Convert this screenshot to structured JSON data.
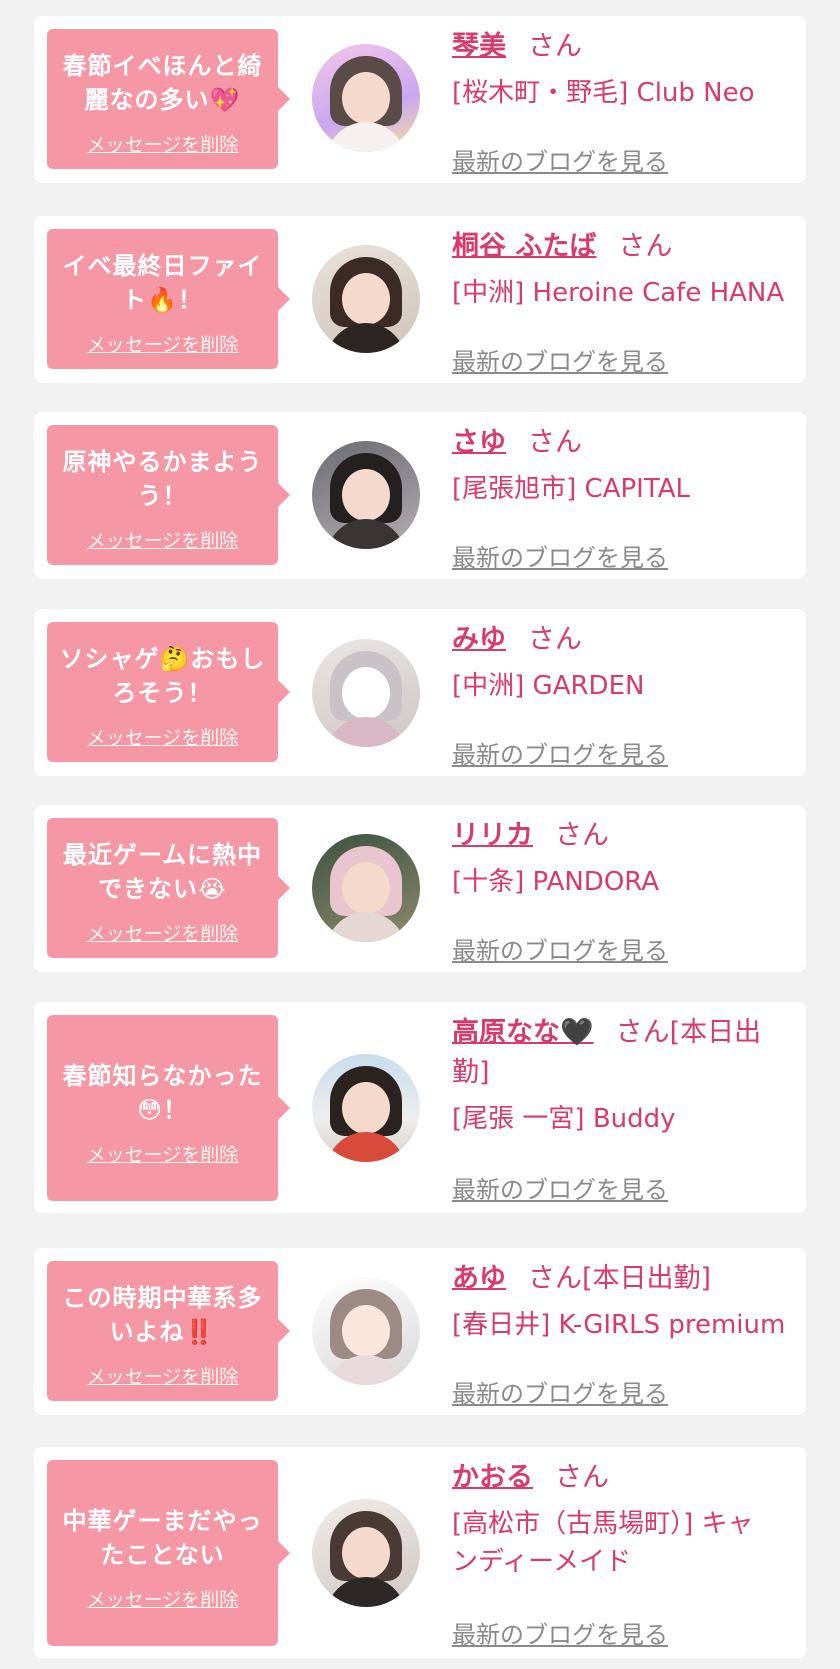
{
  "delete_label": "メッセージを削除",
  "blog_label": "最新のブログを見る",
  "san_suffix": "さん",
  "colors": {
    "accent": "#d93a6c",
    "bubble": "#f597a4",
    "background": "#f2f2f2"
  },
  "items": [
    {
      "message_a": "春節イベほんと綺",
      "message_b": "麗なの多い💖",
      "name": "琴美",
      "suffix": "さん",
      "shop": "[桜木町・野毛] Club Neo"
    },
    {
      "message_a": "イベ最終日ファイ",
      "message_b": "ト🔥！",
      "name": "桐谷 ふたば",
      "suffix": "さん",
      "shop": "[中洲] Heroine Cafe HANA"
    },
    {
      "message_a": "原神やるかまよう",
      "message_b": "う！",
      "name": "さゆ",
      "suffix": "さん",
      "shop": "[尾張旭市] CAPITAL"
    },
    {
      "message_a": "ソシャゲ🤔おもし",
      "message_b": "ろそう！",
      "name": "みゆ",
      "suffix": "さん",
      "shop": "[中洲] GARDEN"
    },
    {
      "message_a": "最近ゲームに熱中",
      "message_b": "できない😭",
      "name": "リリカ",
      "suffix": "さん",
      "shop": "[十条] PANDORA"
    },
    {
      "message_a": "春節知らなかった",
      "message_b": "😳！",
      "name": "高原なな🖤",
      "suffix": "さん[本日出",
      "suffix2": "勤]",
      "shop": "[尾張 一宮] Buddy"
    },
    {
      "message_a": "この時期中華系多",
      "message_b": "いよね‼️",
      "name": "あゆ",
      "suffix": "さん[本日出勤]",
      "shop": "[春日井] K-GIRLS premium"
    },
    {
      "message_a": "中華ゲーまだやっ",
      "message_b": "たことない",
      "name": "かおる",
      "suffix": "さん",
      "shop": "[高松市（古馬場町）] キャ",
      "shop2": "ンディーメイド"
    }
  ]
}
